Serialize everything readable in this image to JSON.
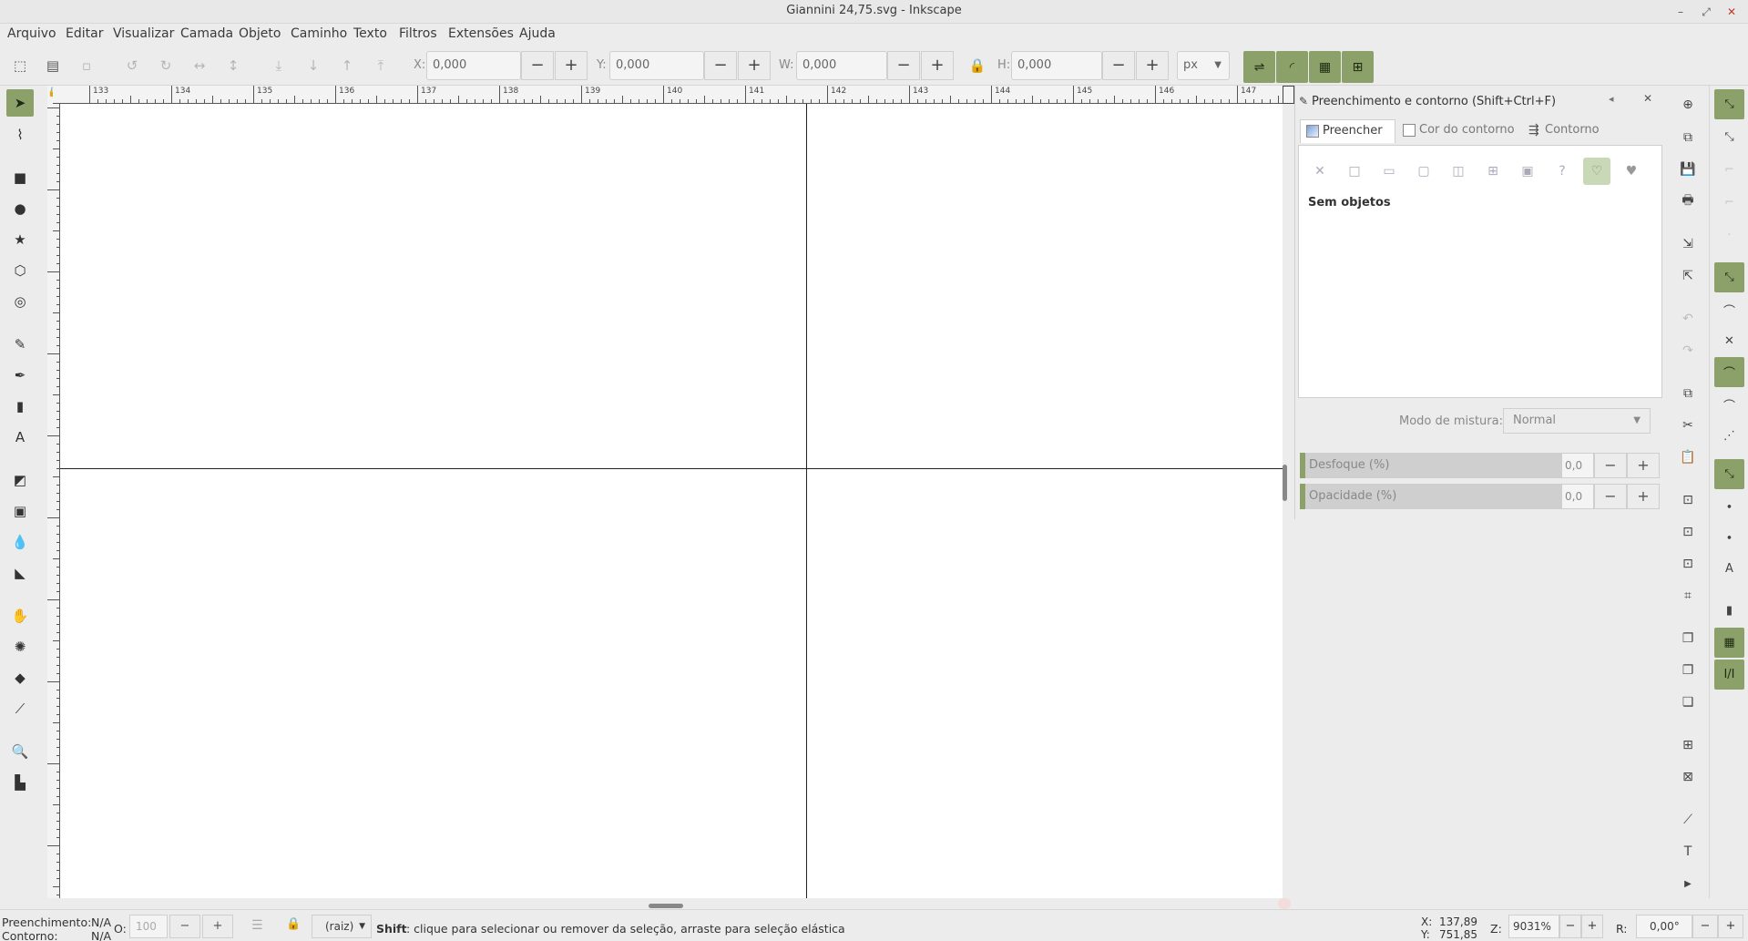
{
  "window": {
    "title": "Giannini 24,75.svg - Inkscape"
  },
  "menubar": [
    "Arquivo",
    "Editar",
    "Visualizar",
    "Camada",
    "Objeto",
    "Caminho",
    "Texto",
    "Filtros",
    "Extensões",
    "Ajuda"
  ],
  "toolbar": {
    "x_label": "X:",
    "x_value": "0,000",
    "y_label": "Y:",
    "y_value": "0,000",
    "w_label": "W:",
    "w_value": "0,000",
    "h_label": "H:",
    "h_value": "0,000",
    "unit": "px",
    "minus": "−",
    "plus": "+"
  },
  "ruler": {
    "labels": [
      "133",
      "134",
      "135",
      "136",
      "137",
      "138",
      "139",
      "140",
      "141",
      "142",
      "143",
      "144",
      "145",
      "146",
      "147"
    ]
  },
  "dock": {
    "title": "Preenchimento e contorno (Shift+Ctrl+F)",
    "tabs": [
      "Preencher",
      "Cor do contorno",
      "Contorno"
    ],
    "paint_icons": [
      "x-icon",
      "flat-color-icon",
      "linear-gradient-icon",
      "radial-gradient-icon",
      "mesh-gradient-icon",
      "pattern-icon",
      "swatch-icon",
      "unset-icon",
      "nonzero-fill-icon",
      "evenodd-fill-icon"
    ],
    "empty_message": "Sem objetos",
    "blend_label": "Modo de mistura:",
    "blend_value": "Normal",
    "blur_label": "Desfoque (%)",
    "blur_value": "0,0",
    "opacity_label": "Opacidade (%)",
    "opacity_value": "0,0"
  },
  "status": {
    "fill_label": "Preenchimento:",
    "fill_value": "N/A",
    "stroke_label": "Contorno:",
    "stroke_value": "N/A",
    "opacity_label": "O:",
    "opacity_value": "100",
    "layer": "(raiz)",
    "hint_key": "Shift",
    "hint_text": ": clique para selecionar ou remover da seleção, arraste para seleção elástica",
    "x_label": "X:",
    "x_value": "137,89",
    "y_label": "Y:",
    "y_value": "751,85",
    "zoom_label": "Z:",
    "zoom_value": "9031%",
    "rotate_label": "R:",
    "rotate_value": "0,00°"
  },
  "colors": {
    "accent": "#8ca06a",
    "canvas": "#ffffff",
    "chrome": "#ececec"
  }
}
